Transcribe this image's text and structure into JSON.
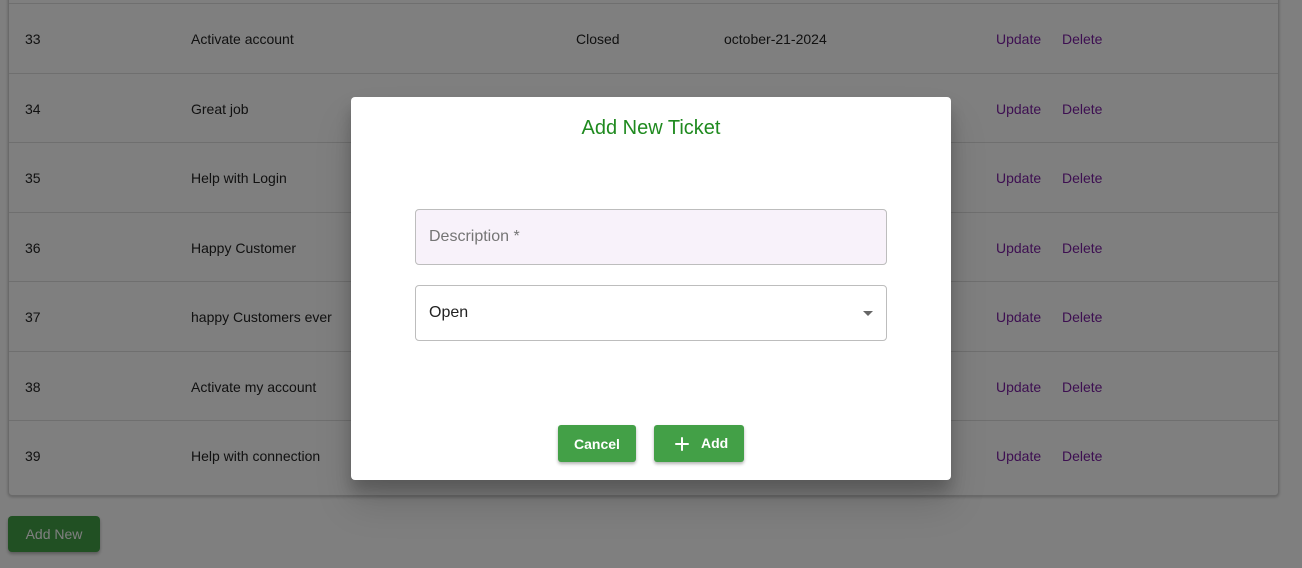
{
  "table": {
    "rows": [
      {
        "id": "33",
        "description": "Activate account",
        "status": "Closed",
        "date": "october-21-2024",
        "update_label": "Update",
        "delete_label": "Delete"
      },
      {
        "id": "34",
        "description": "Great job",
        "status": "",
        "date": "",
        "update_label": "Update",
        "delete_label": "Delete"
      },
      {
        "id": "35",
        "description": "Help with Login",
        "status": "",
        "date": "",
        "update_label": "Update",
        "delete_label": "Delete"
      },
      {
        "id": "36",
        "description": "Happy Customer",
        "status": "",
        "date": "",
        "update_label": "Update",
        "delete_label": "Delete"
      },
      {
        "id": "37",
        "description": "happy Customers ever",
        "status": "",
        "date": "",
        "update_label": "Update",
        "delete_label": "Delete"
      },
      {
        "id": "38",
        "description": "Activate my account",
        "status": "",
        "date": "",
        "update_label": "Update",
        "delete_label": "Delete"
      },
      {
        "id": "39",
        "description": "Help with connection",
        "status": "",
        "date": "",
        "update_label": "Update",
        "delete_label": "Delete"
      }
    ]
  },
  "add_new_label": "Add New",
  "dialog": {
    "title": "Add New Ticket",
    "description_placeholder": "Description *",
    "description_value": "",
    "status_value": "Open",
    "cancel_label": "Cancel",
    "add_label": "Add",
    "add_icon": "plus-icon"
  },
  "colors": {
    "accent_green": "#43a047",
    "title_green": "#1f8a1f",
    "link_purple": "#7b1fa2"
  }
}
